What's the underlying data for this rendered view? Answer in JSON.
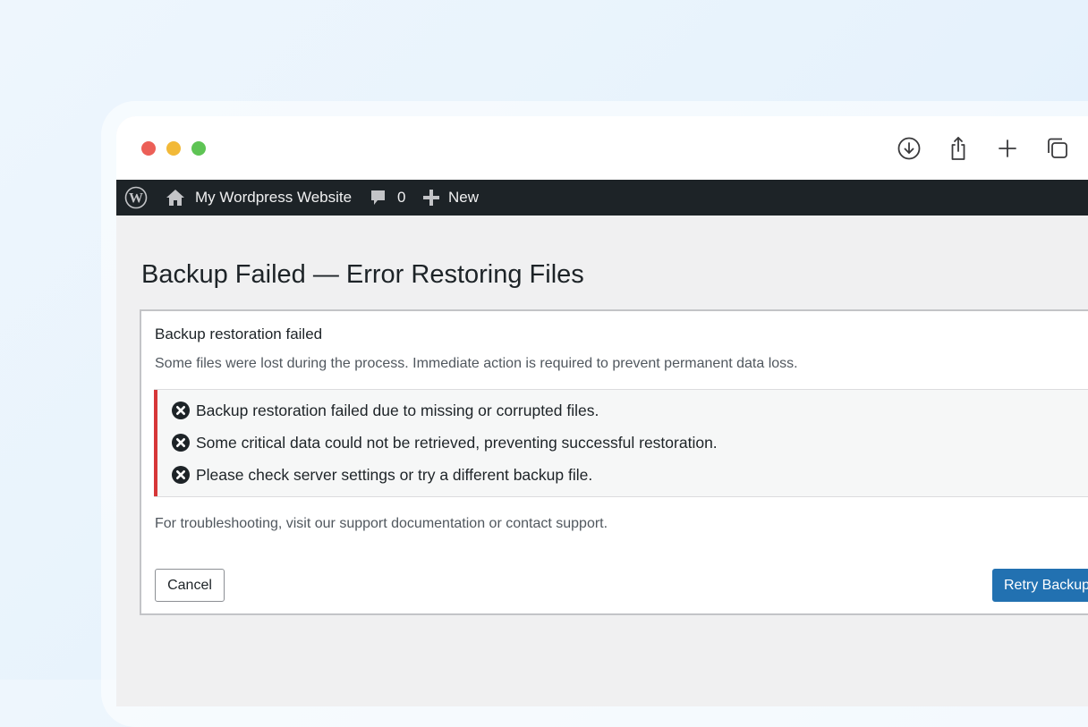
{
  "adminbar": {
    "site_name": "My Wordpress Website",
    "comments_count": "0",
    "new_label": "New",
    "icons": [
      "wordpress-logo-icon",
      "home-icon",
      "comment-icon",
      "plus-icon"
    ]
  },
  "browser": {
    "icons": [
      "download-icon",
      "share-icon",
      "new-tab-icon",
      "tabs-overview-icon"
    ]
  },
  "page": {
    "title": "Backup Failed — Error Restoring Files"
  },
  "card": {
    "heading": "Backup restoration failed",
    "description": "Some files were lost during the process. Immediate action is required to prevent permanent data loss.",
    "errors": [
      "Backup restoration failed due to missing or corrupted files.",
      "Some critical data could not be retrieved, preventing successful restoration.",
      "Please check server settings or try a different backup file."
    ],
    "help": "For troubleshooting, visit our support documentation or contact support.",
    "cancel_label": "Cancel",
    "retry_label": "Retry Backup"
  },
  "colors": {
    "admin_bar": "#1d2327",
    "error_accent": "#d63638",
    "primary_button": "#2271b1",
    "traffic_red": "#ec5f57",
    "traffic_yellow": "#f2b938",
    "traffic_green": "#5ec454"
  }
}
